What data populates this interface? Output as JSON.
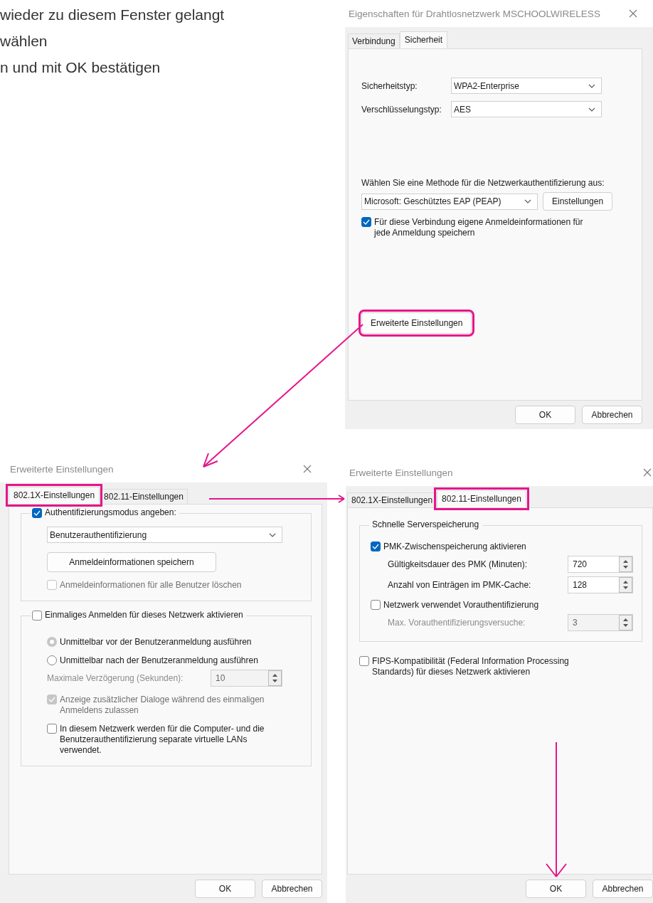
{
  "instructions": [
    "wieder zu diesem Fenster gelangt",
    "wählen",
    "n und mit OK bestätigen"
  ],
  "security_dialog": {
    "title": "Eigenschaften für Drahtlosnetzwerk MSCHOOLWIRELESS",
    "tabs": [
      {
        "label": "Verbindung",
        "selected": false
      },
      {
        "label": "Sicherheit",
        "selected": true
      }
    ],
    "fields": [
      {
        "label": "Sicherheitstyp:",
        "value": "WPA2-Enterprise"
      },
      {
        "label": "Verschlüsselungstyp:",
        "value": "AES"
      }
    ],
    "method_prompt": "Wählen Sie eine Methode für die Netzwerkauthentifizierung aus:",
    "method": "Microsoft: Geschütztes EAP (PEAP)",
    "settings_button": "Einstellungen",
    "remember": {
      "label": "Für diese Verbindung eigene Anmeldeinformationen für jede Anmeldung speichern",
      "checked": true
    },
    "advanced_button": {
      "label": "Erweiterte Einstellungen",
      "highlighted": true
    },
    "buttons": [
      "OK",
      "Abbrechen"
    ]
  },
  "advanced_dialogs": [
    {
      "kind": "authentication",
      "title": "Erweiterte Einstellungen",
      "tabs": [
        {
          "label": "802.1X-Einstellungen",
          "selected": true,
          "highlighted": true
        },
        {
          "label": "802.11-Einstellungen",
          "selected": false,
          "highlighted": false
        }
      ],
      "content": [
        {
          "kind": "group",
          "header": {
            "kind": "checkbox",
            "label": "Authentifizierungsmodus angeben:",
            "checked": true
          },
          "rows": [
            {
              "kind": "dropdown",
              "value": "Benutzerauthentifizierung"
            },
            {
              "kind": "button",
              "label": "Anmeldeinformationen speichern"
            },
            {
              "kind": "checkbox",
              "label": "Anmeldeinformationen für alle Benutzer löschen",
              "checked": false,
              "disabled": true
            }
          ]
        },
        {
          "kind": "group",
          "header": {
            "kind": "checkbox",
            "label": "Einmaliges Anmelden für dieses Netzwerk aktivieren",
            "checked": false
          },
          "rows": [
            {
              "kind": "radio",
              "label": "Unmittelbar vor der Benutzeranmeldung ausführen",
              "selected": true,
              "disabled": true
            },
            {
              "kind": "radio",
              "label": "Unmittelbar nach der Benutzeranmeldung ausführen",
              "selected": false,
              "disabled": false
            },
            {
              "kind": "spin",
              "label": "Maximale Verzögerung (Sekunden):",
              "value": "10",
              "disabled": true
            },
            {
              "kind": "checkbox",
              "label": "Anzeige zusätzlicher Dialoge während des einmaligen Anmeldens zulassen",
              "checked": true,
              "disabled": true
            },
            {
              "kind": "checkbox",
              "label": "In diesem Netzwerk werden für die Computer- und die Benutzerauthentifizierung separate virtuelle LANs verwendet.",
              "checked": false,
              "disabled": false
            }
          ]
        }
      ],
      "buttons": [
        "OK",
        "Abbrechen"
      ]
    },
    {
      "kind": "wireless",
      "title": "Erweiterte Einstellungen",
      "tabs": [
        {
          "label": "802.1X-Einstellungen",
          "selected": false,
          "highlighted": false
        },
        {
          "label": "802.11-Einstellungen",
          "selected": true,
          "highlighted": true
        }
      ],
      "content": [
        {
          "kind": "group",
          "header": {
            "kind": "legend",
            "label": "Schnelle Serverspeicherung"
          },
          "rows": [
            {
              "kind": "checkbox",
              "label": "PMK-Zwischenspeicherung aktivieren",
              "checked": true,
              "disabled": false
            },
            {
              "kind": "spin",
              "label": "Gültigkeitsdauer des PMK (Minuten):",
              "value": "720",
              "disabled": false
            },
            {
              "kind": "spin",
              "label": "Anzahl von Einträgen im PMK-Cache:",
              "value": "128",
              "disabled": false
            },
            {
              "kind": "checkbox",
              "label": "Netzwerk verwendet Vorauthentifizierung",
              "checked": false,
              "disabled": false
            },
            {
              "kind": "spin",
              "label": "Max. Vorauthentifizierungsversuche:",
              "value": "3",
              "disabled": true
            }
          ]
        },
        {
          "kind": "checkbox",
          "label": "FIPS-Kompatibilität (Federal Information Processing Standards) für dieses Netzwerk aktivieren",
          "checked": false,
          "disabled": false
        }
      ],
      "buttons": [
        "OK",
        "Abbrechen"
      ]
    }
  ]
}
